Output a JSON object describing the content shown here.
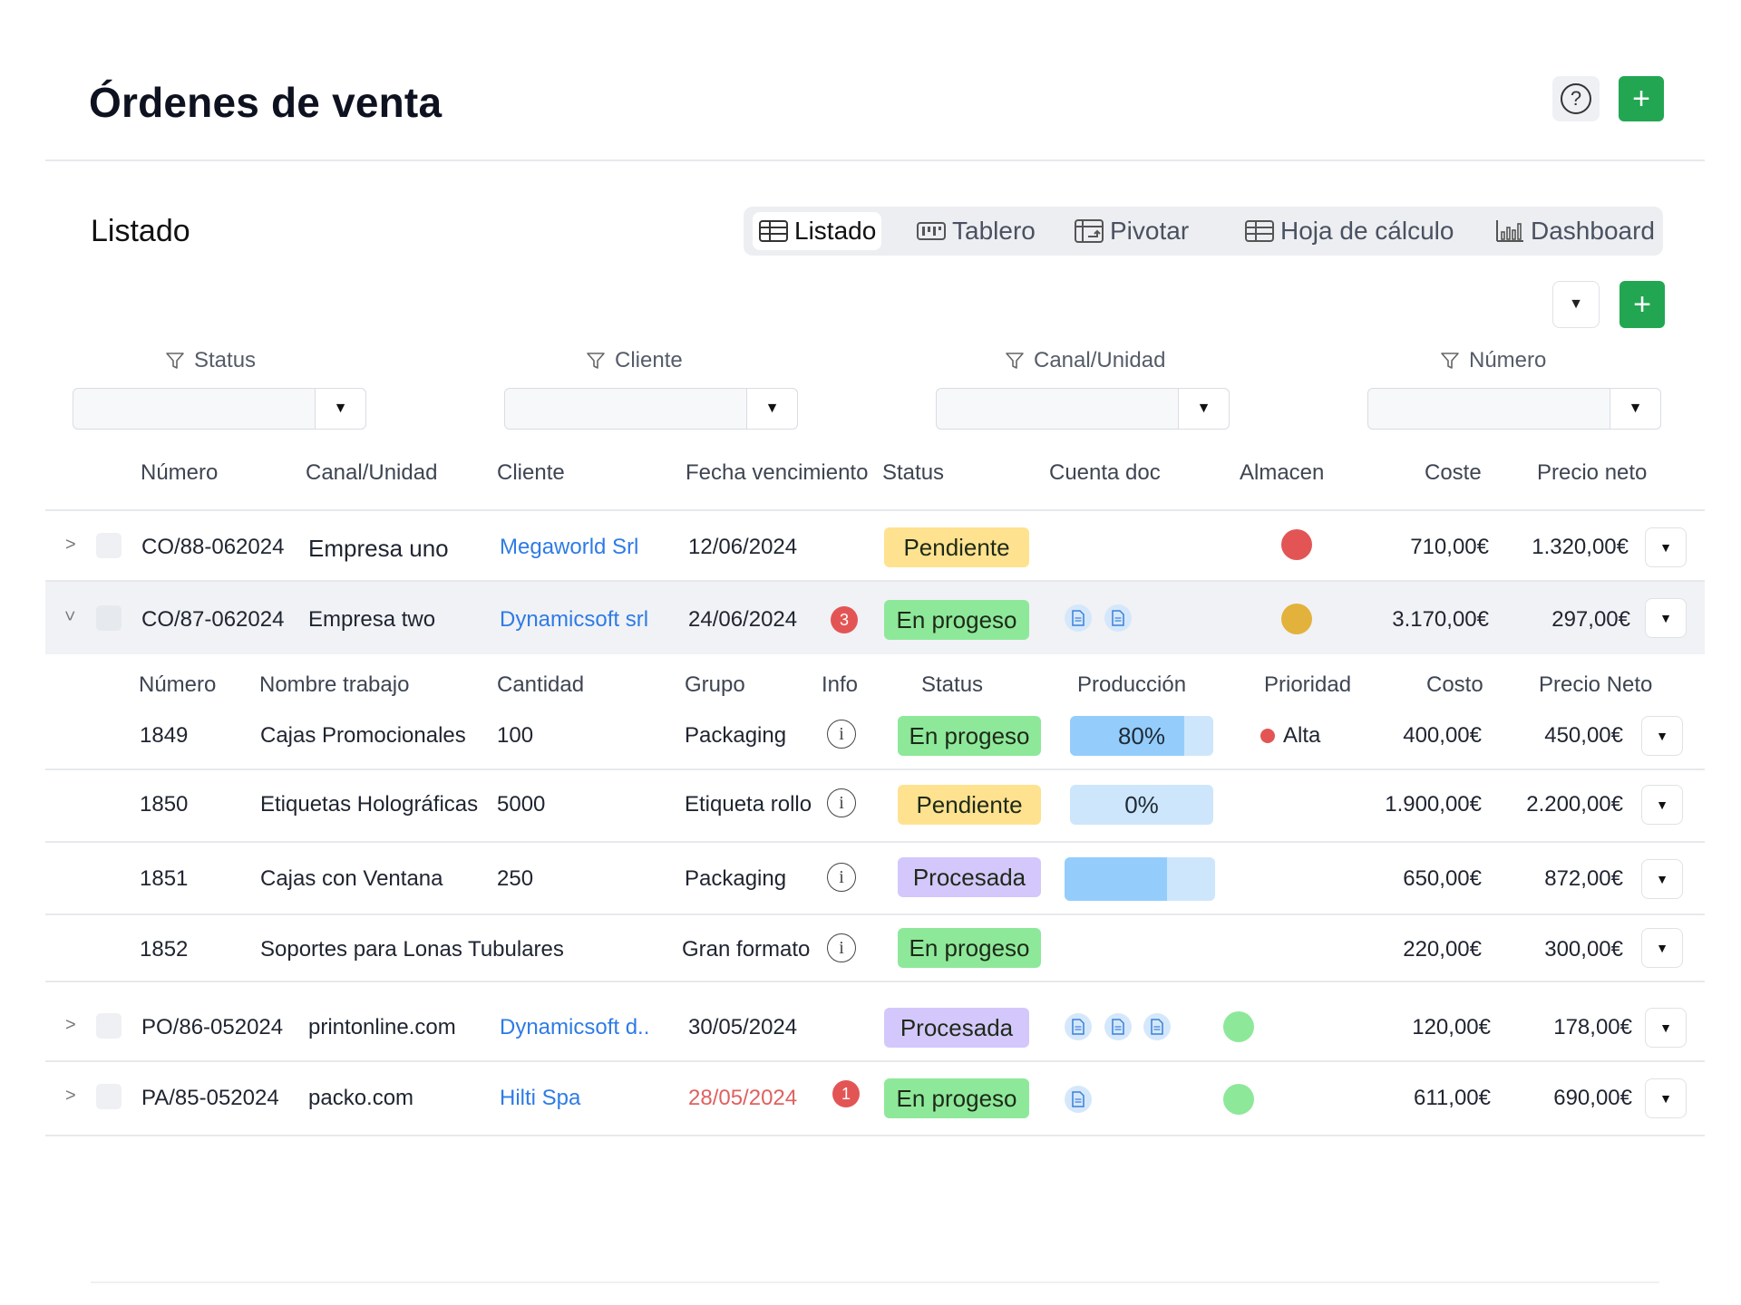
{
  "page": {
    "title": "Órdenes de venta"
  },
  "header": {
    "help_icon": "question-circle-icon",
    "add_icon": "+"
  },
  "section": {
    "title": "Listado"
  },
  "view_tabs": [
    {
      "label": "Listado",
      "icon": "table-icon",
      "active": true
    },
    {
      "label": "Tablero",
      "icon": "board-icon",
      "active": false
    },
    {
      "label": "Pivotar",
      "icon": "pivot-icon",
      "active": false
    },
    {
      "label": "Hoja de cálculo",
      "icon": "spreadsheet-icon",
      "active": false
    },
    {
      "label": "Dashboard",
      "icon": "bar-chart-icon",
      "active": false
    }
  ],
  "toolbar": {
    "columns_icon": "▼",
    "add_icon": "+"
  },
  "filters": [
    {
      "label": "Status",
      "value": ""
    },
    {
      "label": "Cliente",
      "value": ""
    },
    {
      "label": "Canal/Unidad",
      "value": ""
    },
    {
      "label": "Número",
      "value": ""
    }
  ],
  "columns": [
    "Número",
    "Canal/Unidad",
    "Cliente",
    "Fecha vencimiento",
    "Status",
    "Cuenta doc",
    "Almacen",
    "Coste",
    "Precio neto"
  ],
  "orders": [
    {
      "numero": "CO/88-062024",
      "canal": "Empresa uno",
      "cliente": "Megaworld Srl",
      "fecha": "12/06/2024",
      "alerts": "",
      "status": "Pendiente",
      "docs": 0,
      "almacen_color": "#e35555",
      "coste": "710,00€",
      "precio": "1.320,00€",
      "expanded": false
    },
    {
      "numero": "CO/87-062024",
      "canal": "Empresa two",
      "cliente": "Dynamicsoft srl",
      "fecha": "24/06/2024",
      "alerts": "3",
      "status": "En progeso",
      "docs": 2,
      "almacen_color": "#e3b23c",
      "coste": "3.170,00€",
      "precio": "297,00€",
      "expanded": true
    },
    {
      "numero": "PO/86-052024",
      "canal": "printonline.com",
      "cliente": "Dynamicsoft d..",
      "fecha": "30/05/2024",
      "alerts": "",
      "status": "Procesada",
      "docs": 3,
      "almacen_color": "#8ee89a",
      "coste": "120,00€",
      "precio": "178,00€",
      "expanded": false
    },
    {
      "numero": "PA/85-052024",
      "canal": "packo.com",
      "cliente": "Hilti Spa",
      "fecha": "28/05/2024",
      "alerts": "1",
      "status": "En progeso",
      "docs": 1,
      "almacen_color": "#8ee89a",
      "coste": "611,00€",
      "precio": "690,00€",
      "expanded": false,
      "overdue": true
    }
  ],
  "sub_columns": [
    "Número",
    "Nombre trabajo",
    "Cantidad",
    "Grupo",
    "Info",
    "Status",
    "Producción",
    "Prioridad",
    "Costo",
    "Precio Neto"
  ],
  "jobs": [
    {
      "numero": "1849",
      "nombre": "Cajas Promocionales",
      "cantidad": "100",
      "grupo": "Packaging",
      "status": "En progeso",
      "produccion_label": "80%",
      "produccion": 0.8,
      "prioridad": "Alta",
      "costo": "400,00€",
      "precio": "450,00€"
    },
    {
      "numero": "1850",
      "nombre": "Etiquetas Holográficas",
      "cantidad": "5000",
      "grupo": "Etiqueta rollo",
      "status": "Pendiente",
      "produccion_label": "0%",
      "produccion": 0.0,
      "prioridad": "",
      "costo": "1.900,00€",
      "precio": "2.200,00€"
    },
    {
      "numero": "1851",
      "nombre": "Cajas con Ventana",
      "cantidad": "250",
      "grupo": "Packaging",
      "status": "Procesada",
      "produccion_label": "",
      "produccion": 0.68,
      "prioridad": "",
      "costo": "650,00€",
      "precio": "872,00€"
    },
    {
      "numero": "1852",
      "nombre": "Soportes para Lonas Tubulares",
      "cantidad": "",
      "grupo": "Gran formato",
      "status": "En progeso",
      "produccion_label": "",
      "produccion": null,
      "prioridad": "",
      "costo": "220,00€",
      "precio": "300,00€"
    }
  ],
  "colors": {
    "accent_green": "#22a652",
    "link": "#2e7be6",
    "pending": "#ffe28f",
    "progress": "#8ee89a",
    "processed": "#d4c7fb",
    "alert": "#e35555"
  }
}
